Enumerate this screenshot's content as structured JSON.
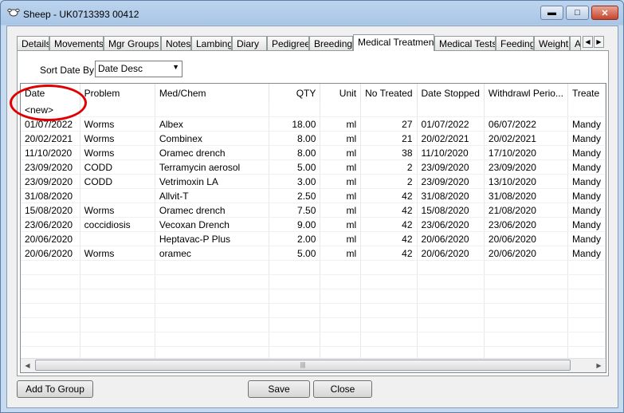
{
  "window": {
    "title": "Sheep - UK0713393 00412",
    "app_icon": "sheep-icon",
    "controls": {
      "minimize": "minimize-icon",
      "maximize": "maximize-icon",
      "close": "close-icon"
    }
  },
  "tabs": [
    "Details",
    "Movements",
    "Mgr Groups",
    "Notes",
    "Lambing",
    "Diary",
    "Pedigree",
    "Breeding",
    "Medical Treatment",
    "Medical Tests",
    "Feeding",
    "Weight",
    "A"
  ],
  "active_tab": "Medical Treatment",
  "sort": {
    "label": "Sort Date By:",
    "value": "Date Desc"
  },
  "grid": {
    "columns": [
      "Date",
      "Problem",
      "Med/Chem",
      "QTY",
      "Unit",
      "No Treated",
      "Date Stopped",
      "Withdrawl Perio...",
      "Treate"
    ],
    "new_row_label": "<new>",
    "rows": [
      [
        "01/07/2022",
        "Worms",
        "Albex",
        "18.00",
        "ml",
        "27",
        "01/07/2022",
        "06/07/2022",
        "Mandy"
      ],
      [
        "20/02/2021",
        "Worms",
        "Combinex",
        "8.00",
        "ml",
        "21",
        "20/02/2021",
        "20/02/2021",
        "Mandy"
      ],
      [
        "11/10/2020",
        "Worms",
        "Oramec drench",
        "8.00",
        "ml",
        "38",
        "11/10/2020",
        "17/10/2020",
        "Mandy"
      ],
      [
        "23/09/2020",
        "CODD",
        "Terramycin aerosol",
        "5.00",
        "ml",
        "2",
        "23/09/2020",
        "23/09/2020",
        "Mandy"
      ],
      [
        "23/09/2020",
        "CODD",
        "Vetrimoxin LA",
        "3.00",
        "ml",
        "2",
        "23/09/2020",
        "13/10/2020",
        "Mandy"
      ],
      [
        "31/08/2020",
        "",
        "Allvit-T",
        "2.50",
        "ml",
        "42",
        "31/08/2020",
        "31/08/2020",
        "Mandy"
      ],
      [
        "15/08/2020",
        "Worms",
        "Oramec drench",
        "7.50",
        "ml",
        "42",
        "15/08/2020",
        "21/08/2020",
        "Mandy"
      ],
      [
        "23/06/2020",
        "coccidiosis",
        "Vecoxan Drench",
        "9.00",
        "ml",
        "42",
        "23/06/2020",
        "23/06/2020",
        "Mandy"
      ],
      [
        "20/06/2020",
        "",
        "Heptavac-P Plus",
        "2.00",
        "ml",
        "42",
        "20/06/2020",
        "20/06/2020",
        "Mandy"
      ],
      [
        "20/06/2020",
        "Worms",
        "oramec",
        "5.00",
        "ml",
        "42",
        "20/06/2020",
        "20/06/2020",
        "Mandy"
      ]
    ]
  },
  "buttons": {
    "add_to_group": "Add To Group",
    "save": "Save",
    "close": "Close"
  },
  "annotation_color": "#e00000"
}
